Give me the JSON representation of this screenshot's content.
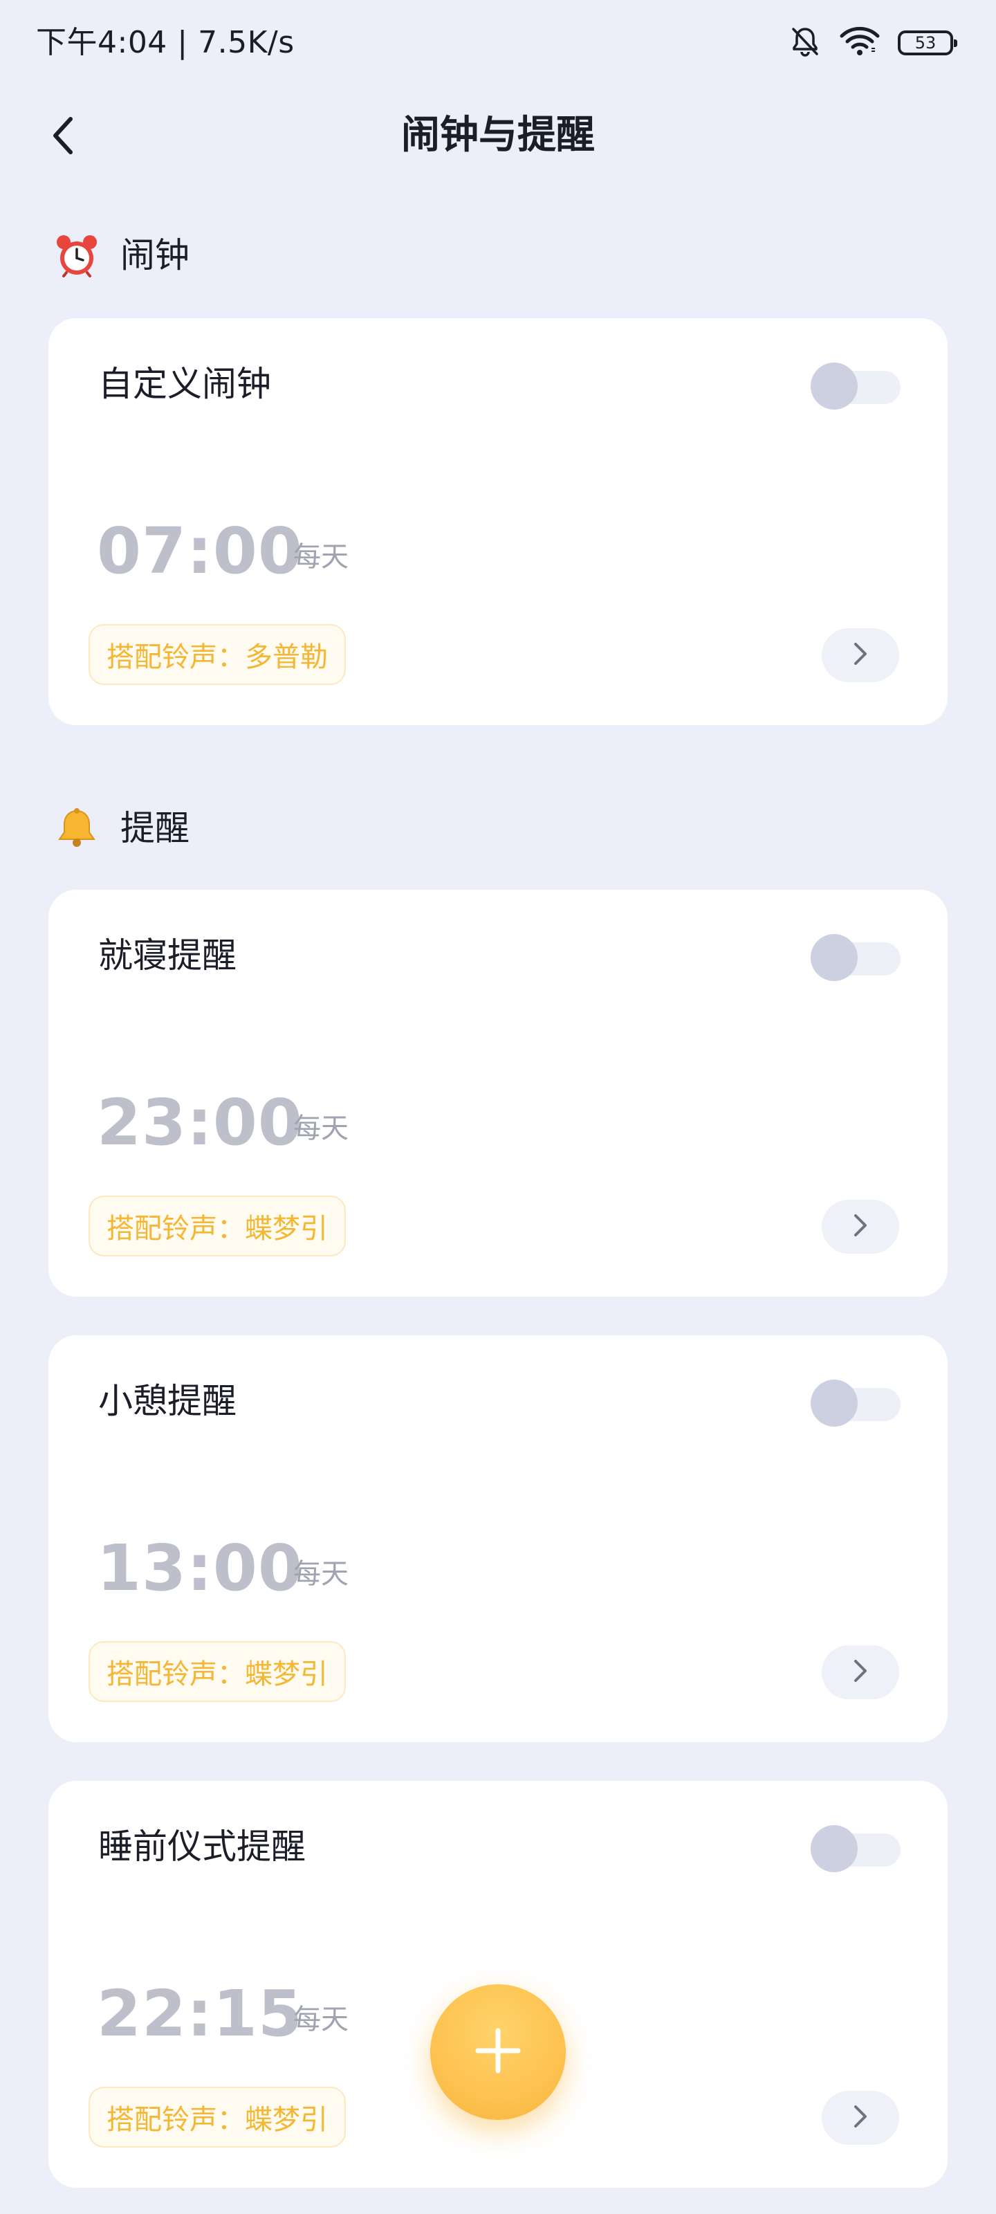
{
  "status_bar": {
    "time_speed": "下午4:04 | 7.5K/s",
    "battery_level": "53",
    "icons": [
      "bell-muted-icon",
      "wifi-icon",
      "battery-icon"
    ]
  },
  "header": {
    "back_icon": "chevron-left-icon",
    "title": "闹钟与提醒"
  },
  "sections": {
    "alarm": {
      "emoji": "alarm-clock-icon",
      "title": "闹钟"
    },
    "reminder": {
      "emoji": "bell-icon",
      "title": "提醒"
    }
  },
  "cards": [
    {
      "title": "自定义闹钟",
      "enabled": false,
      "time": "07:00",
      "repeat": "每天",
      "ringtone": "搭配铃声：多普勒"
    },
    {
      "title": "就寝提醒",
      "enabled": false,
      "time": "23:00",
      "repeat": "每天",
      "ringtone": "搭配铃声：蝶梦引"
    },
    {
      "title": "小憩提醒",
      "enabled": false,
      "time": "13:00",
      "repeat": "每天",
      "ringtone": "搭配铃声：蝶梦引"
    },
    {
      "title": "睡前仪式提醒",
      "enabled": false,
      "time": "22:15",
      "repeat": "每天",
      "ringtone": "搭配铃声：蝶梦引"
    }
  ],
  "fab": {
    "icon": "plus-icon"
  },
  "colors": {
    "background": "#ECEFFA",
    "card": "#FFFFFF",
    "accent": "#FDC250",
    "ringtone_text": "#F5B733",
    "time_text": "#BDBFCA"
  }
}
